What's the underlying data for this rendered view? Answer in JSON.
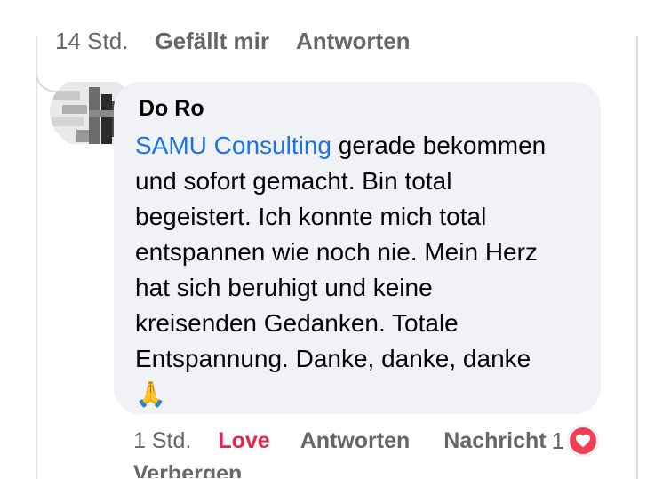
{
  "previous_comment": {
    "time": "14 Std.",
    "like_label": "Gefällt mir",
    "reply_label": "Antworten"
  },
  "comment": {
    "author": "Do Ro",
    "mention": "SAMU Consulting",
    "text_lines": [
      " gerade bekommen",
      "und sofort gemacht. Bin total",
      "begeistert. Ich konnte mich total",
      "entspannen wie noch nie. Mein Herz",
      "hat sich beruhigt und keine",
      "kreisenden Gedanken. Totale",
      "Entspannung. Danke, danke, danke"
    ],
    "emoji": "🙏",
    "emoji_icon": "folded-hands-icon"
  },
  "footer": {
    "time": "1 Std.",
    "reaction_label": "Love",
    "reply_label": "Antworten",
    "message_label": "Nachricht",
    "reaction_count": "1",
    "reaction_icon": "heart-icon",
    "hide_label": "Verbergen"
  },
  "colors": {
    "bubble": "#f0f2f5",
    "mention": "#1b74e4",
    "love": "#e4244a",
    "heart_badge": "#f33e58",
    "muted": "#65676b"
  }
}
